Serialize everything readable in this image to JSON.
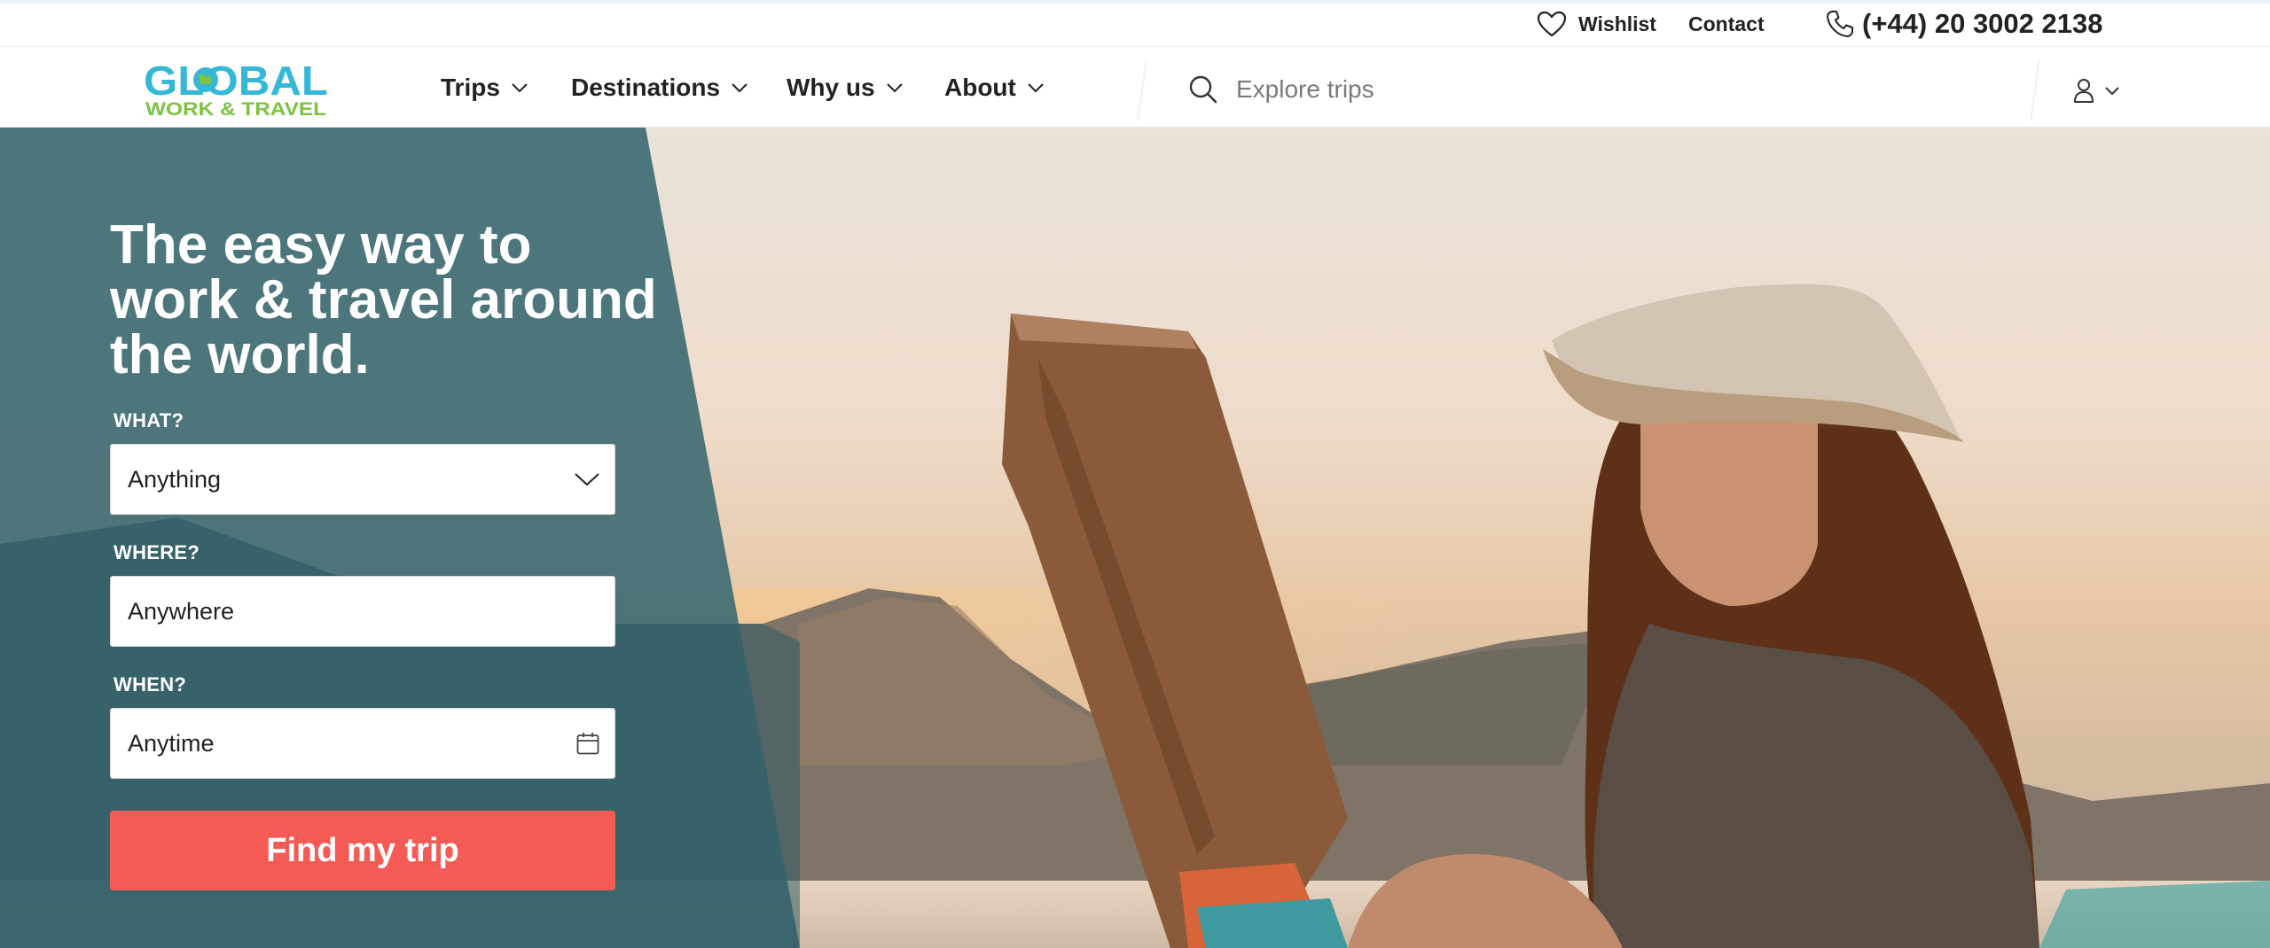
{
  "utility_bar": {
    "wishlist_label": "Wishlist",
    "contact_label": "Contact",
    "phone": "(+44) 20 3002 2138"
  },
  "logo": {
    "line1": "GLOBAL",
    "line2": "WORK & TRAVEL",
    "colors": {
      "primary": "#35b8d8",
      "secondary": "#7dc242"
    }
  },
  "nav": {
    "items": [
      {
        "label": "Trips"
      },
      {
        "label": "Destinations"
      },
      {
        "label": "Why us"
      },
      {
        "label": "About"
      }
    ]
  },
  "search": {
    "placeholder": "Explore trips"
  },
  "hero": {
    "headline": "The easy way to work & travel around the world.",
    "form": {
      "what_label": "WHAT?",
      "what_value": "Anything",
      "where_label": "WHERE?",
      "where_value": "Anywhere",
      "when_label": "WHEN?",
      "when_value": "Anytime",
      "submit_label": "Find my trip"
    },
    "colors": {
      "panel": "#3f6c74",
      "button": "#f45b55"
    }
  },
  "icons": [
    "heart-icon",
    "phone-icon",
    "chevron-down-icon",
    "search-icon",
    "user-icon",
    "calendar-icon"
  ]
}
